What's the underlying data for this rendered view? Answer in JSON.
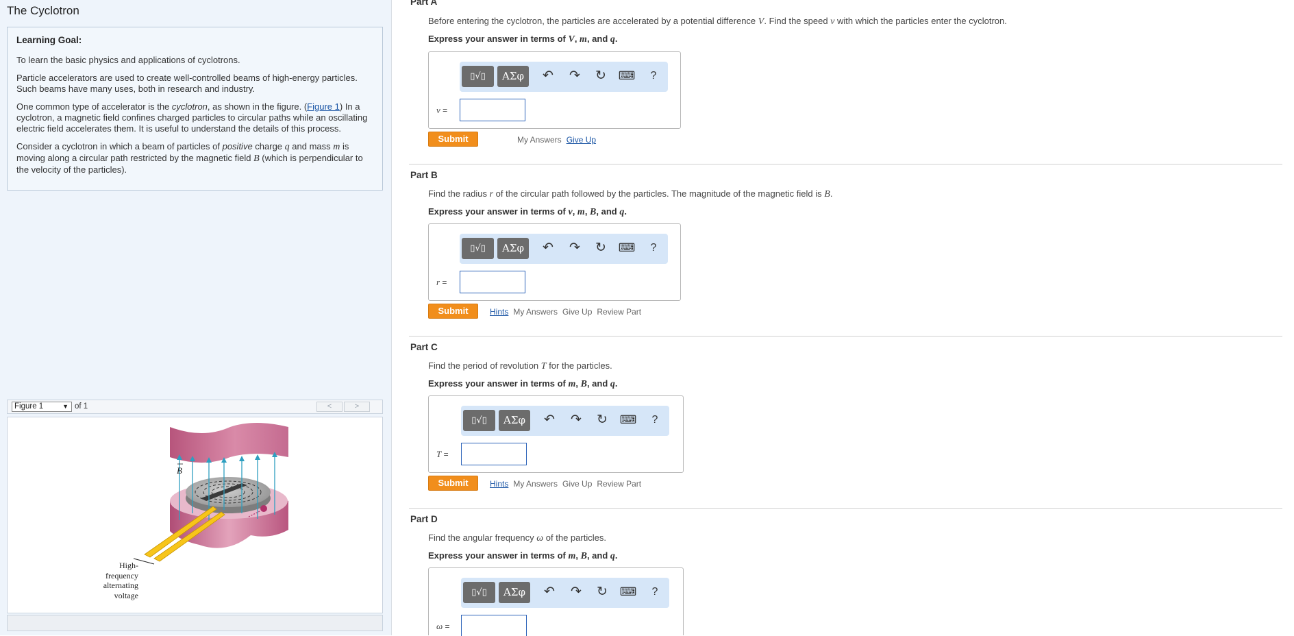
{
  "app": {
    "title": "The Cyclotron"
  },
  "goal": {
    "heading": "Learning Goal:",
    "p1": "To learn the basic physics and applications of cyclotrons.",
    "p2": "Particle accelerators are used to create well-controlled beams of high-energy particles. Such beams have many uses, both in research and industry.",
    "p3a": "One common type of accelerator is the ",
    "p3_em": "cyclotron",
    "p3b": ", as shown in the figure. (",
    "p3_link": "Figure 1",
    "p3c": ") In a cyclotron, a magnetic field confines charged particles to circular paths while an oscillating electric field accelerates them. It is useful to understand the details of this process.",
    "p4a": "Consider a cyclotron in which a beam of particles of ",
    "p4_em": "positive",
    "p4b": " charge ",
    "p4_q": "q",
    "p4c": " and mass ",
    "p4_m": "m",
    "p4d": " is moving along a circular path restricted by the magnetic field ",
    "p4_B": "B",
    "p4e": " (which is perpendicular to the velocity of the particles)."
  },
  "figure": {
    "select_value": "Figure 1",
    "of_label": "of 1",
    "prev": "<",
    "next": ">",
    "b_label": "B",
    "caption": [
      "High-",
      "frequency",
      "alternating",
      "voltage"
    ]
  },
  "toolbar": {
    "templates": "▯√▯",
    "symbols": "ΑΣφ",
    "undo": "↶",
    "redo": "↷",
    "reset": "↻",
    "keyboard": "⌨",
    "help": "?"
  },
  "parts": [
    {
      "title": "Part A",
      "question": [
        "Before entering the cyclotron, the particles are accelerated by a potential difference ",
        "V",
        ". Find the speed ",
        "v",
        " with which the particles enter the cyclotron."
      ],
      "express": [
        "Express your answer in terms of ",
        "V",
        ", ",
        "m",
        ", and ",
        "q",
        "."
      ],
      "var": "v",
      "eq": " =",
      "submit": "Submit",
      "links": [
        "My Answers",
        "Give Up"
      ]
    },
    {
      "title": "Part B",
      "question": [
        "Find the radius ",
        "r",
        " of the circular path followed by the particles. The magnitude of the magnetic field is ",
        "B",
        "."
      ],
      "express": [
        "Express your answer in terms of ",
        "v",
        ", ",
        "m",
        ", ",
        "B",
        ", and ",
        "q",
        "."
      ],
      "var": "r",
      "eq": " =",
      "submit": "Submit",
      "links": [
        "Hints",
        "My Answers",
        "Give Up",
        "Review Part"
      ]
    },
    {
      "title": "Part C",
      "question": [
        "Find the period of revolution ",
        "T",
        " for the particles."
      ],
      "express": [
        "Express your answer in terms of ",
        "m",
        ", ",
        "B",
        ", and ",
        "q",
        "."
      ],
      "var": "T",
      "eq": " =",
      "submit": "Submit",
      "links": [
        "Hints",
        "My Answers",
        "Give Up",
        "Review Part"
      ]
    },
    {
      "title": "Part D",
      "question": [
        "Find the angular frequency ",
        "ω",
        " of the particles."
      ],
      "express": [
        "Express your answer in terms of ",
        "m",
        ", ",
        "B",
        ", and ",
        "q",
        "."
      ],
      "var": "ω",
      "eq": " ="
    }
  ],
  "colors": {
    "submit": "#f18e1c",
    "toolbar_bg": "#d6e6f8",
    "link": "#1a55a5",
    "left_bg": "#eef4fb"
  }
}
